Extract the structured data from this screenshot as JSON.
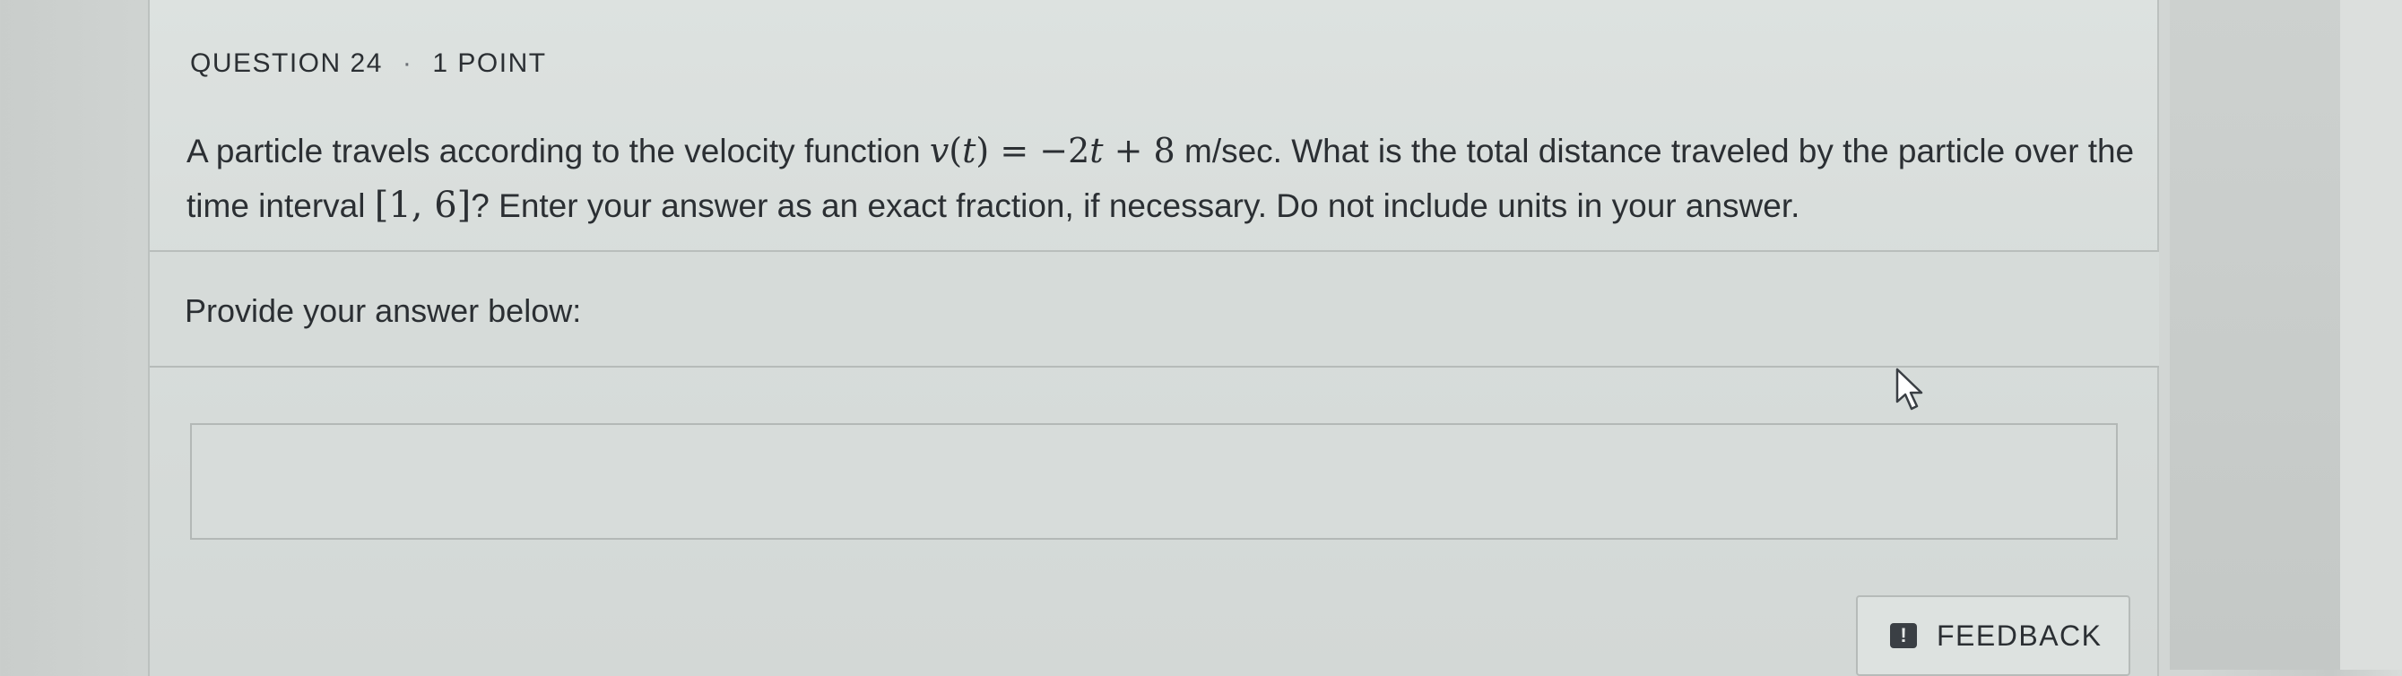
{
  "question": {
    "number_label": "QUESTION 24",
    "separator": "·",
    "points_label": "1 POINT",
    "text_part1": "A particle travels according to the velocity function ",
    "func_v": "v",
    "func_t": "t",
    "equation_rhs": "= −2",
    "equation_t": "t",
    "equation_tail": " + 8",
    "text_part2": " m/sec. What is the total distance traveled by the particle over the time interval ",
    "interval": "[1, 6]",
    "text_part3": "? Enter your answer as an exact fraction, if necessary. Do not include units in your answer."
  },
  "answer": {
    "prompt": "Provide your answer below:",
    "value": "",
    "placeholder": ""
  },
  "feedback": {
    "icon": "feedback-exclamation-icon",
    "icon_glyph": "!",
    "label": "FEEDBACK"
  },
  "cursor": {
    "icon": "mouse-pointer-icon"
  }
}
